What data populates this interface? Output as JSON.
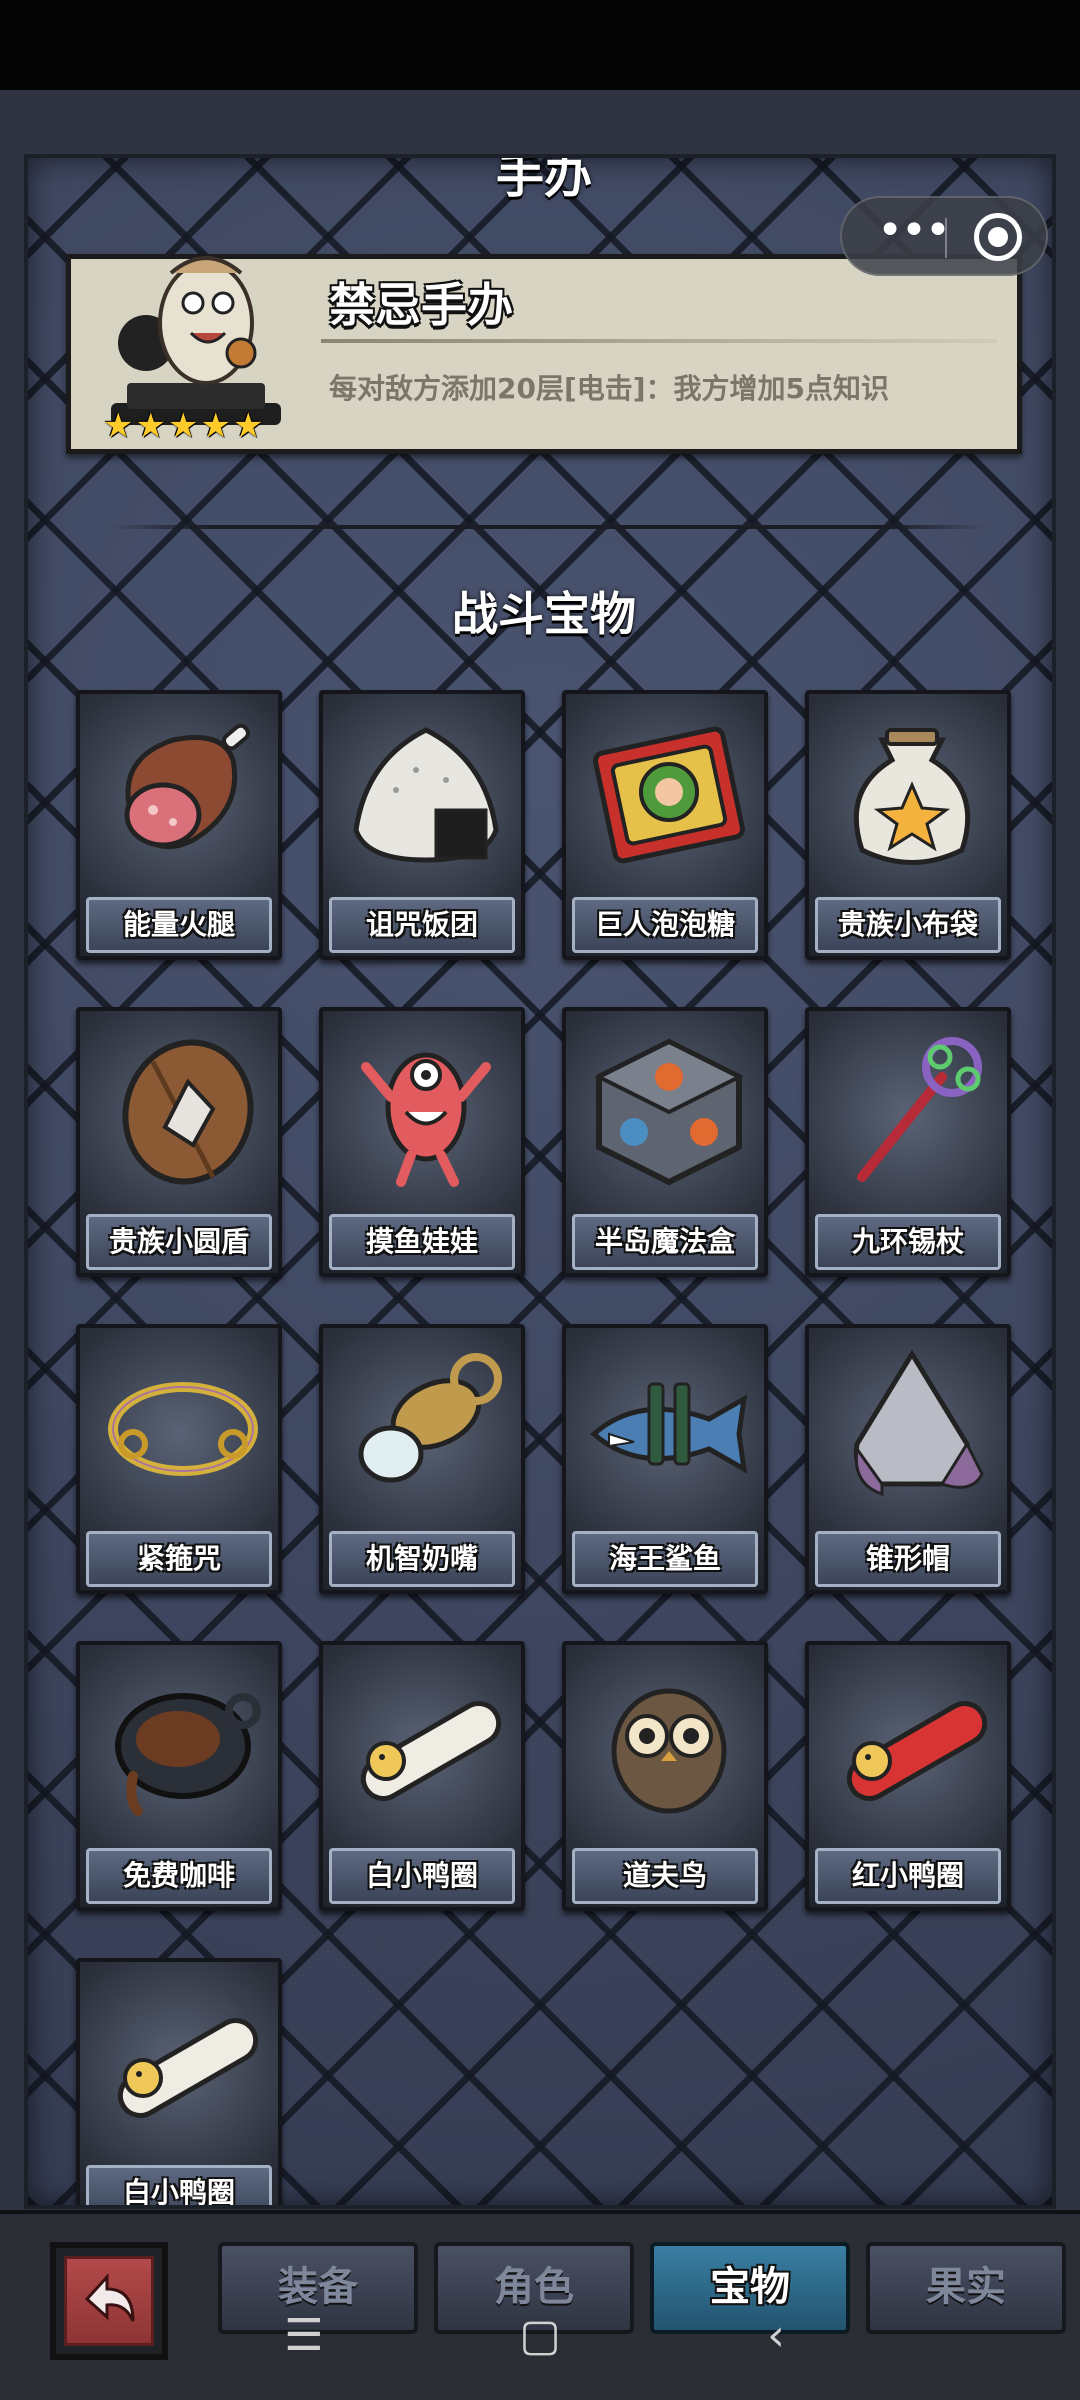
{
  "header": {
    "section_title_top": "手办"
  },
  "featured": {
    "name": "禁忌手办",
    "description": "每对敌方添加20层[电击]：我方增加5点知识",
    "stars": 5
  },
  "battle_treasures": {
    "title": "战斗宝物",
    "items": [
      {
        "label": "能量火腿",
        "icon": "ham-icon"
      },
      {
        "label": "诅咒饭团",
        "icon": "rice-ball-icon"
      },
      {
        "label": "巨人泡泡糖",
        "icon": "gum-box-icon"
      },
      {
        "label": "贵族小布袋",
        "icon": "cloth-bag-icon"
      },
      {
        "label": "贵族小圆盾",
        "icon": "round-shield-icon"
      },
      {
        "label": "摸鱼娃娃",
        "icon": "fish-doll-icon"
      },
      {
        "label": "半岛魔法盒",
        "icon": "magic-box-icon"
      },
      {
        "label": "九环锡杖",
        "icon": "staff-icon"
      },
      {
        "label": "紧箍咒",
        "icon": "golden-band-icon"
      },
      {
        "label": "机智奶嘴",
        "icon": "pacifier-icon"
      },
      {
        "label": "海王鲨鱼",
        "icon": "shark-icon"
      },
      {
        "label": "锥形帽",
        "icon": "cone-helmet-icon"
      },
      {
        "label": "免费咖啡",
        "icon": "coffee-pot-icon"
      },
      {
        "label": "白小鸭圈",
        "icon": "white-duck-ring-icon"
      },
      {
        "label": "道夫鸟",
        "icon": "owl-icon"
      },
      {
        "label": "红小鸭圈",
        "icon": "red-duck-ring-icon"
      },
      {
        "label": "白小鸭圈",
        "icon": "white-duck-ring-icon"
      }
    ]
  },
  "tabs": [
    {
      "label": "装备"
    },
    {
      "label": "角色"
    },
    {
      "label": "宝物",
      "active": true
    },
    {
      "label": "果实"
    }
  ],
  "system_nav": {
    "menu_icon": "menu-icon",
    "home_icon": "home-icon",
    "back_icon": "back-chevron-icon"
  },
  "colors": {
    "panel_bg": "#3e4760",
    "active_tab": "#3a7fa3",
    "star": "#ffcb2a"
  }
}
